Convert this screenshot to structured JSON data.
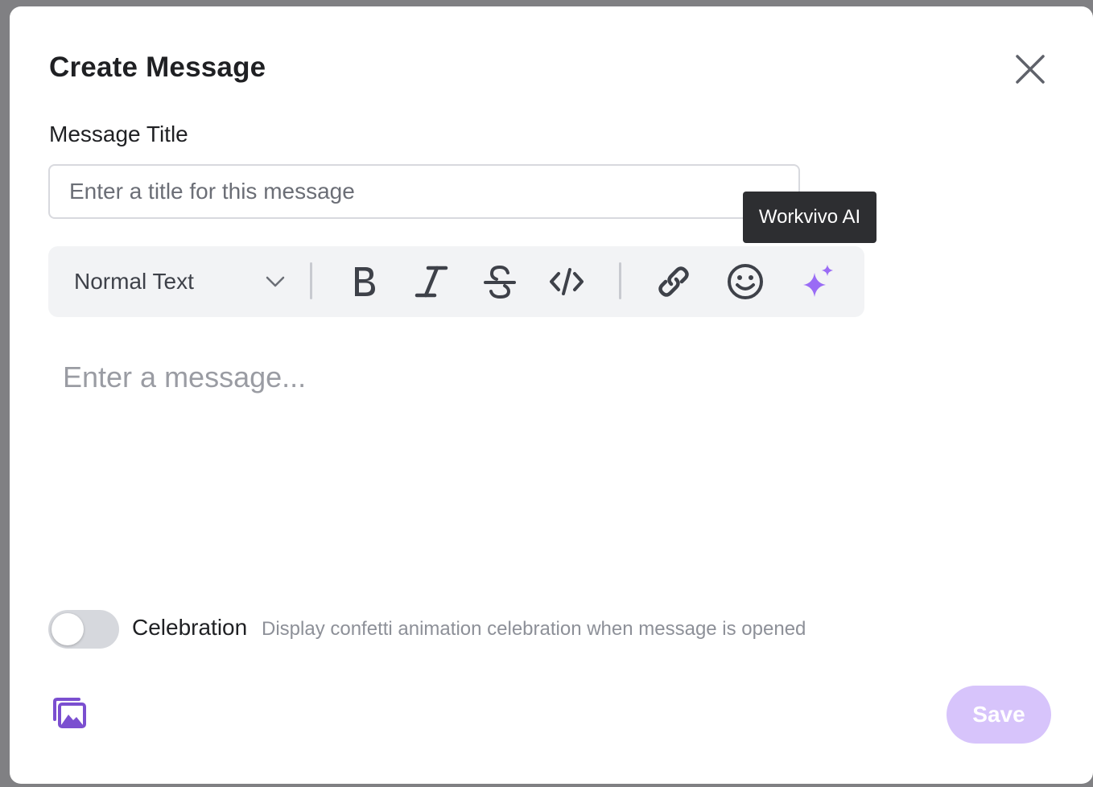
{
  "dialog": {
    "title": "Create Message"
  },
  "message_title": {
    "label": "Message Title",
    "placeholder": "Enter a title for this message",
    "value": ""
  },
  "toolbar": {
    "text_style": "Normal Text",
    "tooltip": "Workvivo AI",
    "buttons": [
      {
        "name": "bold",
        "icon": "bold-icon"
      },
      {
        "name": "italic",
        "icon": "italic-icon"
      },
      {
        "name": "strikethrough",
        "icon": "strikethrough-icon"
      },
      {
        "name": "code",
        "icon": "code-icon"
      },
      {
        "name": "link",
        "icon": "link-icon"
      },
      {
        "name": "emoji",
        "icon": "emoji-icon"
      },
      {
        "name": "workvivo-ai",
        "icon": "sparkles-icon"
      }
    ]
  },
  "message": {
    "placeholder": "Enter a message...",
    "value": ""
  },
  "celebration": {
    "label": "Celebration",
    "description": "Display confetti animation celebration when message is opened",
    "enabled": false
  },
  "footer": {
    "save_label": "Save",
    "media_icon": "image-gallery-icon"
  },
  "colors": {
    "accent": "#8b5cf6",
    "save_disabled": "#d7c4fb",
    "ai_sparkles": "#9a6cf5",
    "media_icon": "#7b4fd0",
    "toggle_off": "#d6d8dd"
  }
}
